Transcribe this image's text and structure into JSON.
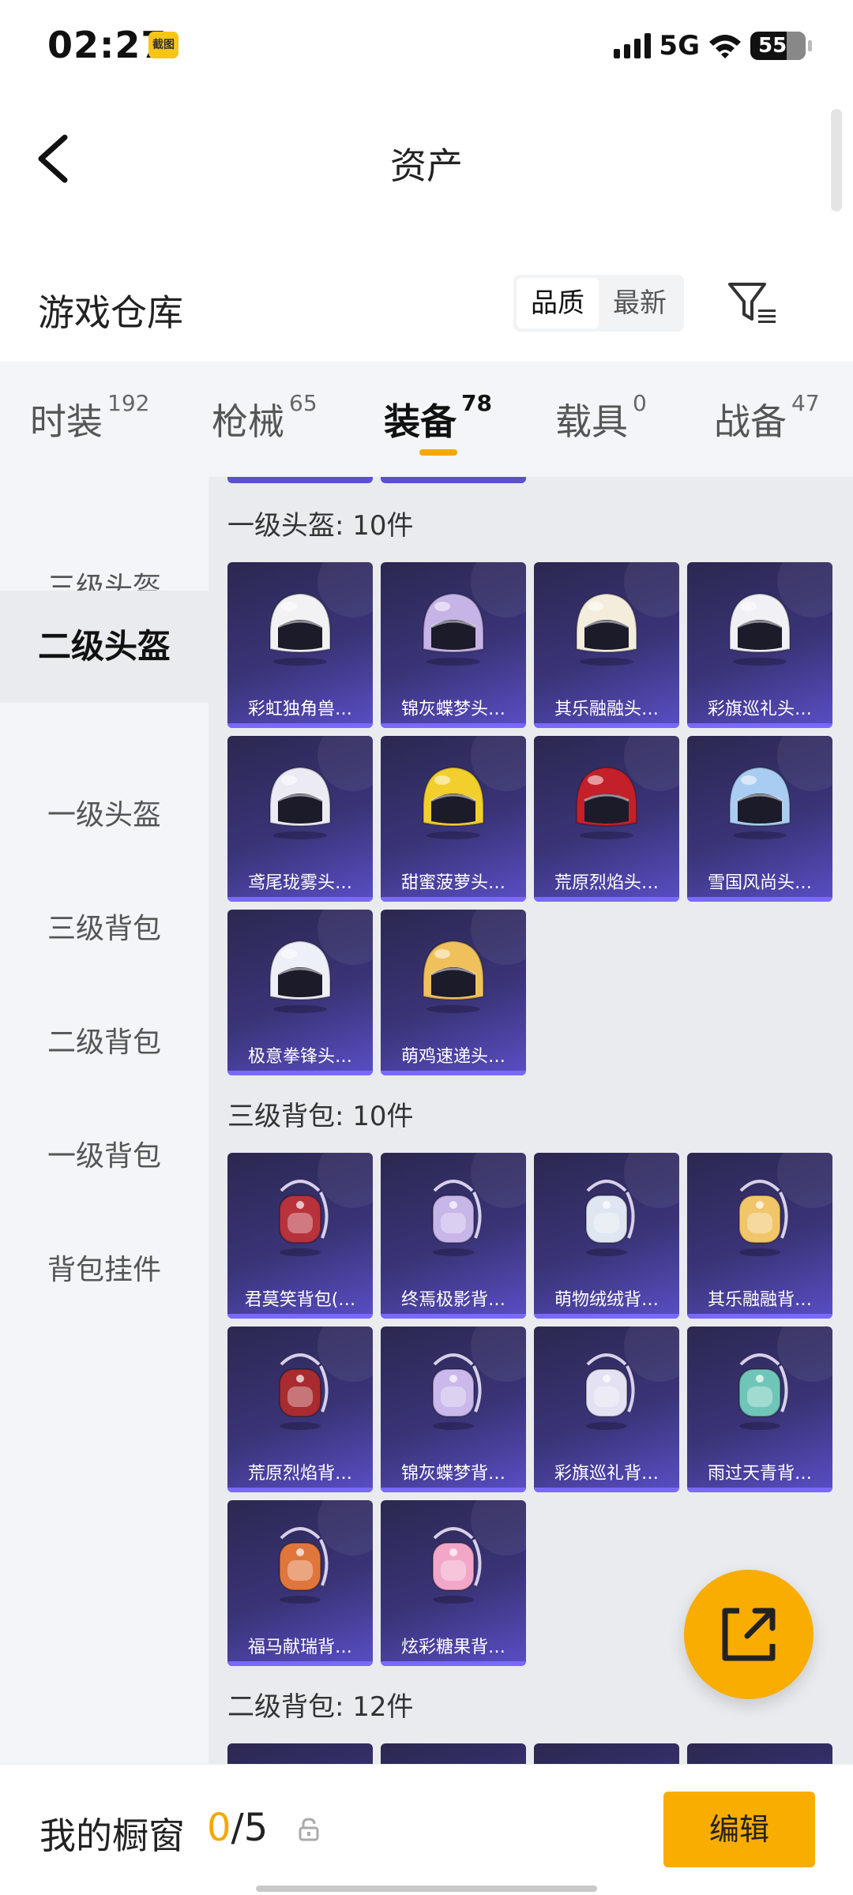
{
  "status_bar": {
    "time": "02:27",
    "app_badge": "截图",
    "network": "5G",
    "battery": "55"
  },
  "header": {
    "title": "资产"
  },
  "warehouse": {
    "title": "游戏仓库",
    "sort_options": [
      "品质",
      "最新"
    ],
    "active_sort": "品质"
  },
  "tabs": [
    {
      "label": "时装",
      "count": "192"
    },
    {
      "label": "枪械",
      "count": "65"
    },
    {
      "label": "装备",
      "count": "78",
      "active": true
    },
    {
      "label": "载具",
      "count": "0"
    },
    {
      "label": "战备",
      "count": "47"
    }
  ],
  "sidebar": {
    "items": [
      {
        "label": "三级头盔"
      },
      {
        "label": "二级头盔",
        "active": true
      },
      {
        "label": "一级头盔"
      },
      {
        "label": "三级背包"
      },
      {
        "label": "二级背包"
      },
      {
        "label": "一级背包"
      },
      {
        "label": "背包挂件"
      }
    ]
  },
  "sections": [
    {
      "title": "一级头盔: 10件",
      "items": [
        {
          "label": "彩虹独角兽…",
          "icon": "helmet-icon",
          "color": "#f2f2f4"
        },
        {
          "label": "锦灰蝶梦头…",
          "icon": "helmet-icon",
          "color": "#c7b4e6"
        },
        {
          "label": "其乐融融头…",
          "icon": "helmet-icon",
          "color": "#f4eddc"
        },
        {
          "label": "彩旗巡礼头…",
          "icon": "helmet-icon",
          "color": "#f0f0f5"
        },
        {
          "label": "鸢尾珑雾头…",
          "icon": "helmet-icon",
          "color": "#ecebf4"
        },
        {
          "label": "甜蜜菠萝头…",
          "icon": "helmet-icon",
          "color": "#f2cf2c"
        },
        {
          "label": "荒原烈焰头…",
          "icon": "helmet-icon",
          "color": "#c4202a"
        },
        {
          "label": "雪国风尚头…",
          "icon": "helmet-icon",
          "color": "#a9cdf2"
        },
        {
          "label": "极意拳锋头…",
          "icon": "helmet-icon",
          "color": "#eef0f8"
        },
        {
          "label": "萌鸡速递头…",
          "icon": "helmet-icon",
          "color": "#f0c15a"
        }
      ]
    },
    {
      "title": "三级背包: 10件",
      "items": [
        {
          "label": "君莫笑背包(…",
          "icon": "backpack-icon",
          "color": "#b8323c"
        },
        {
          "label": "终焉极影背…",
          "icon": "backpack-icon",
          "color": "#c7b6e8"
        },
        {
          "label": "萌物绒绒背…",
          "icon": "backpack-icon",
          "color": "#dfe6f2"
        },
        {
          "label": "其乐融融背…",
          "icon": "backpack-icon",
          "color": "#f1c56a"
        },
        {
          "label": "荒原烈焰背…",
          "icon": "backpack-icon",
          "color": "#a82b30"
        },
        {
          "label": "锦灰蝶梦背…",
          "icon": "backpack-icon",
          "color": "#cbb8ec"
        },
        {
          "label": "彩旗巡礼背…",
          "icon": "backpack-icon",
          "color": "#e4e2f2"
        },
        {
          "label": "雨过天青背…",
          "icon": "backpack-icon",
          "color": "#6fc6b8"
        },
        {
          "label": "福马献瑞背…",
          "icon": "backpack-icon",
          "color": "#e0763c"
        },
        {
          "label": "炫彩糖果背…",
          "icon": "backpack-icon",
          "color": "#f3a7c8"
        }
      ]
    },
    {
      "title": "二级背包: 12件",
      "items": []
    }
  ],
  "showcase": {
    "label": "我的橱窗",
    "current": "0",
    "total": "/5"
  },
  "edit_button": "编辑",
  "colors": {
    "accent": "#f8ad00",
    "card_gradient_end": "#5a4ec6",
    "card_bar": "#7a69ff"
  }
}
